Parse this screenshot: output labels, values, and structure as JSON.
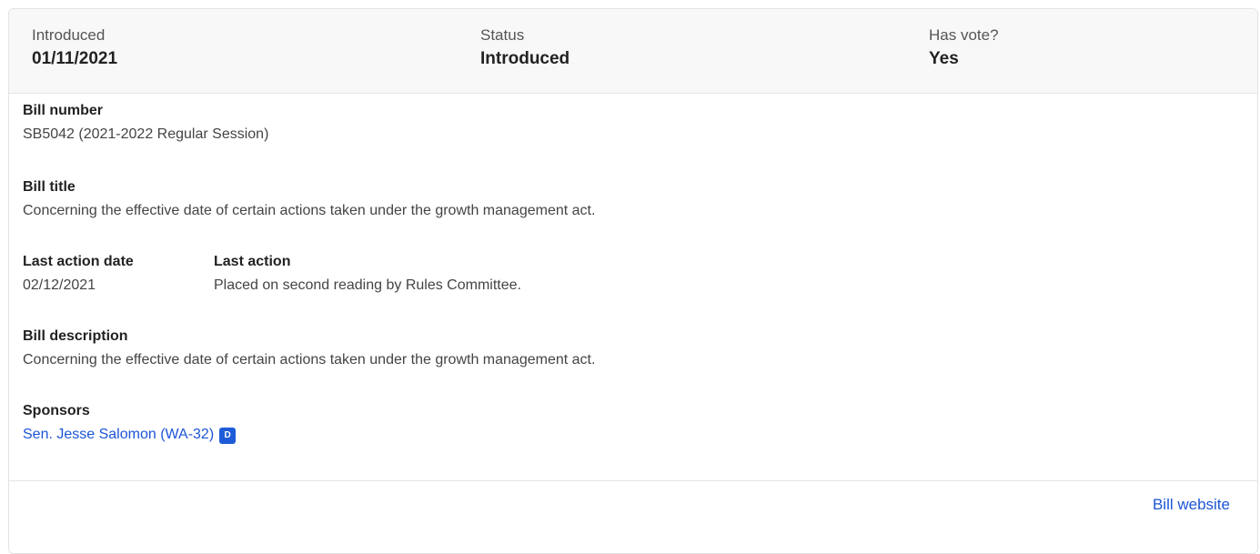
{
  "summary": {
    "introduced_label": "Introduced",
    "introduced_value": "01/11/2021",
    "status_label": "Status",
    "status_value": "Introduced",
    "vote_label": "Has vote?",
    "vote_value": "Yes"
  },
  "details": {
    "bill_number_label": "Bill number",
    "bill_number_value": "SB5042 (2021-2022 Regular Session)",
    "bill_title_label": "Bill title",
    "bill_title_value": "Concerning the effective date of certain actions taken under the growth management act.",
    "last_action_date_label": "Last action date",
    "last_action_date_value": "02/12/2021",
    "last_action_label": "Last action",
    "last_action_value": "Placed on second reading by Rules Committee.",
    "bill_description_label": "Bill description",
    "bill_description_value": "Concerning the effective date of certain actions taken under the growth management act.",
    "sponsors_label": "Sponsors",
    "sponsors": [
      {
        "name": "Sen. Jesse Salomon (WA-32)",
        "party": "D"
      }
    ]
  },
  "footer": {
    "bill_website_label": "Bill website"
  },
  "colors": {
    "link": "#1c55d6",
    "party_democrat": "#1e5bd8",
    "summary_bg": "#f8f8f8"
  }
}
